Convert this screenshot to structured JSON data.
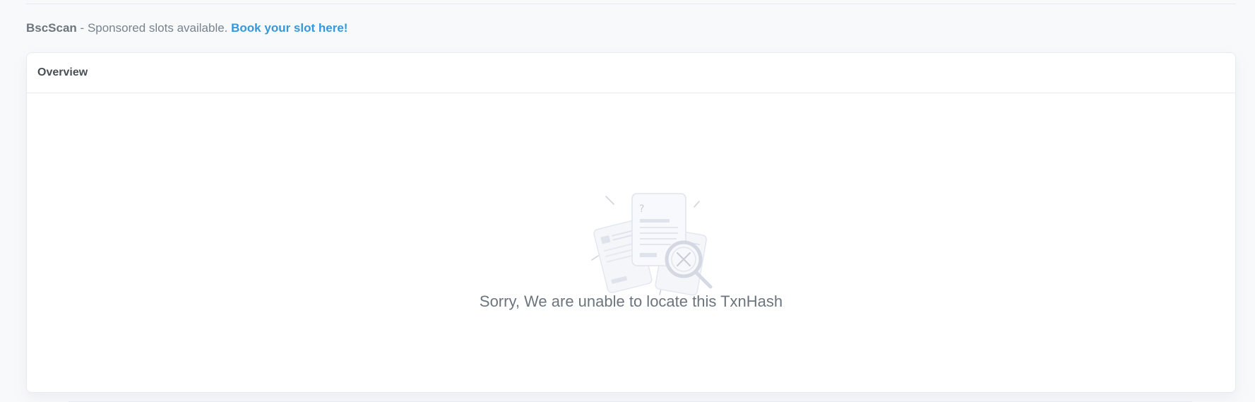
{
  "sponsor": {
    "brand": "BscScan",
    "separator": " - ",
    "text": "Sponsored slots available.",
    "link_label": "Book your slot here!"
  },
  "card": {
    "title": "Overview",
    "message": "Sorry, We are unable to locate this TxnHash"
  },
  "illustration": {
    "icon": "document-search-not-found-icon",
    "glyph": "?"
  },
  "colors": {
    "background": "#f8f9fa",
    "link": "#3498db",
    "text_muted": "#6c757d",
    "border": "#e7eaf3"
  }
}
